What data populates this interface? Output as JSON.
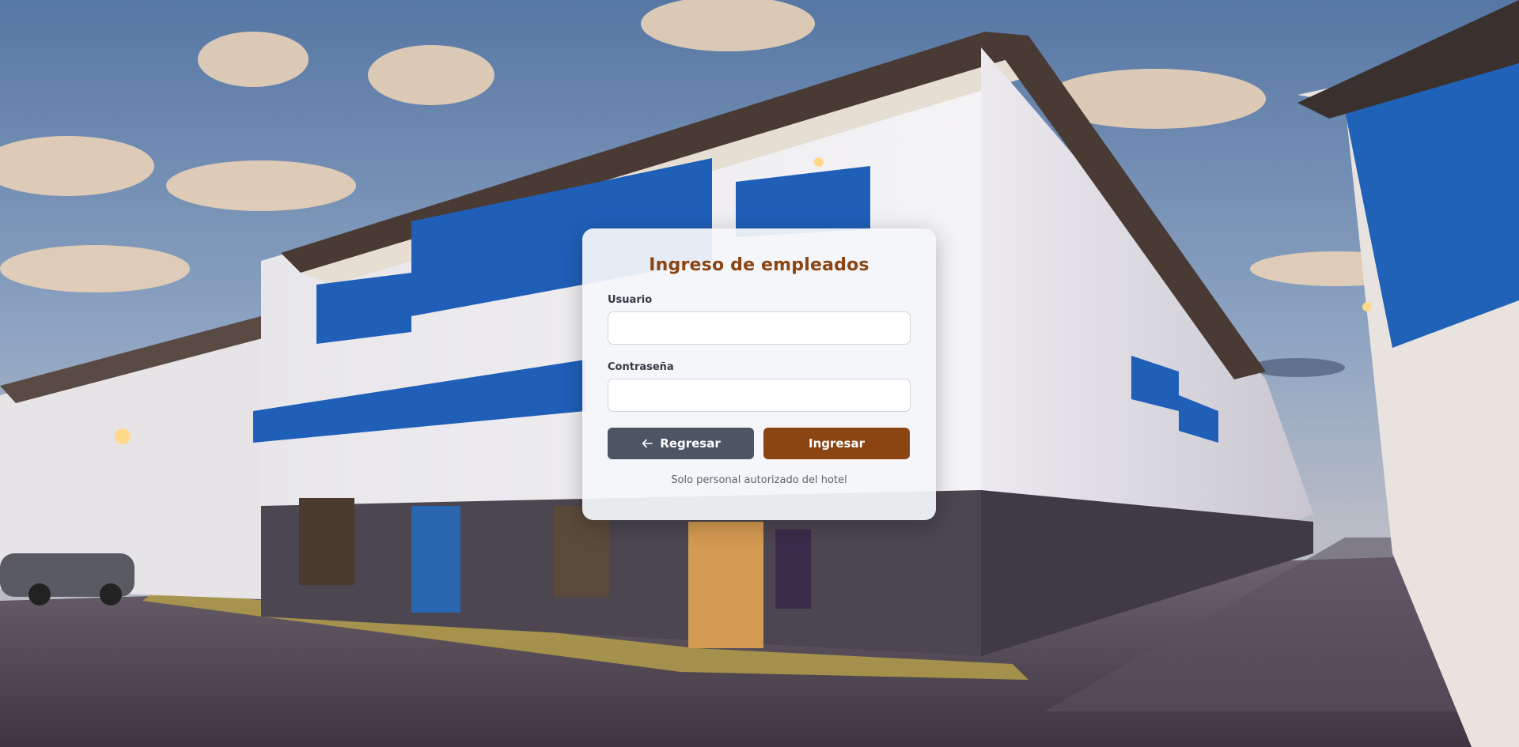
{
  "login": {
    "title": "Ingreso de empleados",
    "username_label": "Usuario",
    "username_value": "",
    "password_label": "Contraseña",
    "password_value": "",
    "back_label": "Regresar",
    "back_icon": "arrow-left-icon",
    "submit_label": "Ingresar",
    "footnote": "Solo personal autorizado del hotel"
  },
  "colors": {
    "title": "#8b4513",
    "submit_button": "#8b4513",
    "back_button": "#4b5563",
    "card_background": "#f4f6fa"
  }
}
